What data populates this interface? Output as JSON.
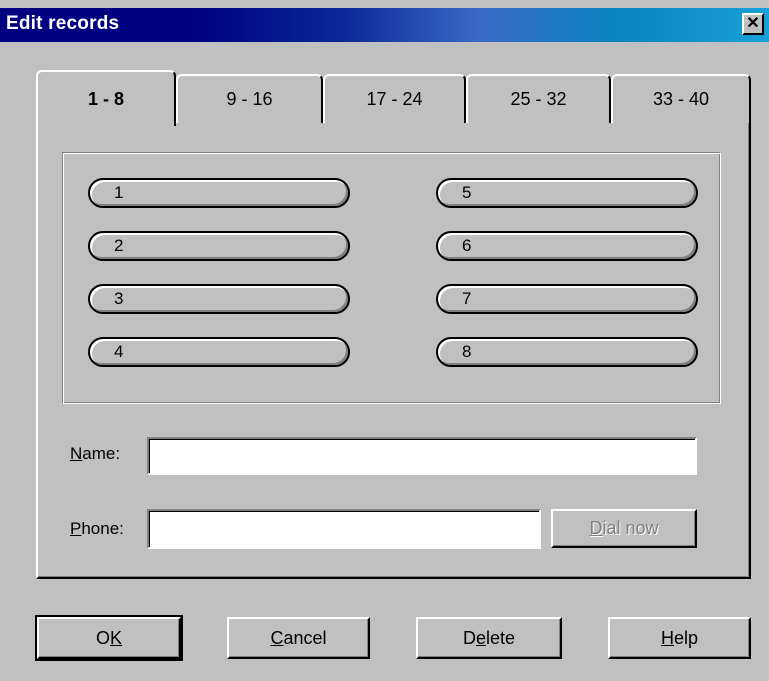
{
  "window": {
    "title": "Edit records",
    "close_icon": "close-icon",
    "titlebar_color": "#000080"
  },
  "tabs": [
    {
      "label": "1 - 8",
      "active": true
    },
    {
      "label": "9 - 16",
      "active": false
    },
    {
      "label": "17 - 24",
      "active": false
    },
    {
      "label": "25 - 32",
      "active": false
    },
    {
      "label": "33 - 40",
      "active": false
    }
  ],
  "records": {
    "left": [
      "1",
      "2",
      "3",
      "4"
    ],
    "right": [
      "5",
      "6",
      "7",
      "8"
    ]
  },
  "fields": {
    "name": {
      "label_rest": "ame:",
      "label_hotkey": "N",
      "value": ""
    },
    "phone": {
      "label_rest": "hone:",
      "label_hotkey": "P",
      "value": ""
    }
  },
  "dial_button": {
    "hotkey": "D",
    "rest": "ial now",
    "enabled": false
  },
  "buttons": {
    "ok": {
      "pre": "O",
      "hotkey": "K",
      "post": ""
    },
    "cancel": {
      "pre": "",
      "hotkey": "C",
      "post": "ancel"
    },
    "delete": {
      "pre": "D",
      "hotkey": "e",
      "post": "lete"
    },
    "help": {
      "pre": "",
      "hotkey": "H",
      "post": "elp"
    }
  }
}
